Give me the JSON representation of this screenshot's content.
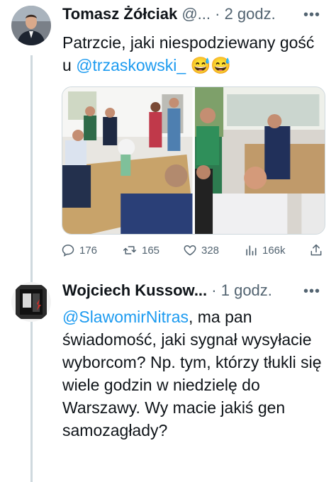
{
  "tweet1": {
    "author_name": "Tomasz Żółciak",
    "handle_truncated": "@...",
    "separator": "·",
    "time": "2 godz.",
    "text_plain": "Patrzcie, jaki niespodziewany gość u ",
    "mention": "@trzaskowski_",
    "emoji": " 😅😅",
    "stats": {
      "replies": "176",
      "retweets": "165",
      "likes": "328",
      "views": "166k"
    }
  },
  "tweet2": {
    "author_name": "Wojciech Kussow...",
    "separator": "·",
    "time": "1 godz.",
    "mention": "@SlawomirNitras",
    "text_plain": ", ma pan świadomość, jaki sygnał wysyłacie wyborcom? Np. tym, którzy tłukli się wiele godzin w niedzielę do Warszawy. Wy macie jakiś gen samozagłady?"
  },
  "icons": [
    "avatar",
    "reply-icon",
    "retweet-icon",
    "like-icon",
    "views-icon",
    "share-icon",
    "more-icon"
  ],
  "colors": {
    "text": "#0f1419",
    "muted": "#536471",
    "link": "#1d9bf0",
    "line": "#cfd9de"
  }
}
